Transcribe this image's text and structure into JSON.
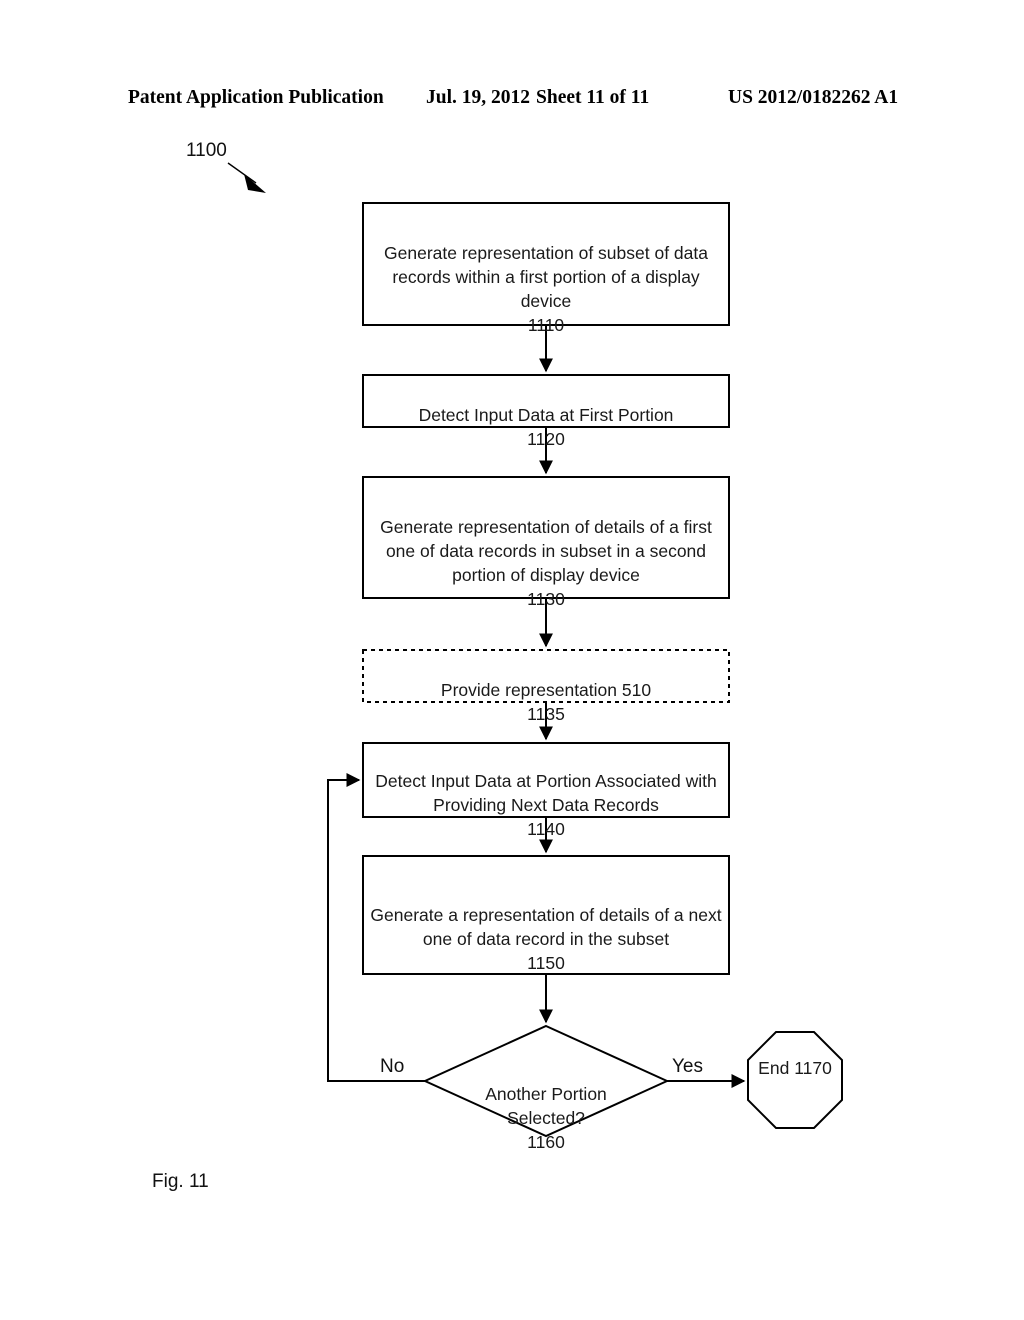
{
  "header": {
    "publication": "Patent Application Publication",
    "date": "Jul. 19, 2012",
    "sheet": "Sheet 11 of 11",
    "patent_number": "US 2012/0182262 A1"
  },
  "figure": {
    "caption": "Fig. 11",
    "reference_numeral": "1100"
  },
  "diagram": {
    "type": "flowchart",
    "nodes": [
      {
        "id": "1110",
        "shape": "rectangle",
        "border": "solid",
        "text": "Generate representation of subset of data records within a first portion of a display device",
        "ref": "1110"
      },
      {
        "id": "1120",
        "shape": "rectangle",
        "border": "solid",
        "text": "Detect Input Data at First Portion",
        "ref": "1120"
      },
      {
        "id": "1130",
        "shape": "rectangle",
        "border": "solid",
        "text": "Generate representation of details of a first one of data records in subset in a second portion of display device",
        "ref": "1130"
      },
      {
        "id": "1135",
        "shape": "rectangle",
        "border": "dashed",
        "text": "Provide representation 510",
        "ref": "1135"
      },
      {
        "id": "1140",
        "shape": "rectangle",
        "border": "solid",
        "text": "Detect Input Data at Portion Associated with Providing Next Data Records",
        "ref": "1140"
      },
      {
        "id": "1150",
        "shape": "rectangle",
        "border": "solid",
        "text": "Generate a representation of details of a next one of data record in the subset",
        "ref": "1150"
      },
      {
        "id": "1160",
        "shape": "diamond",
        "border": "solid",
        "text": "Another Portion Selected?",
        "ref": "1160"
      },
      {
        "id": "1170",
        "shape": "octagon",
        "border": "solid",
        "text": "End",
        "ref": "1170"
      }
    ],
    "branch_labels": {
      "no": "No",
      "yes": "Yes"
    }
  }
}
